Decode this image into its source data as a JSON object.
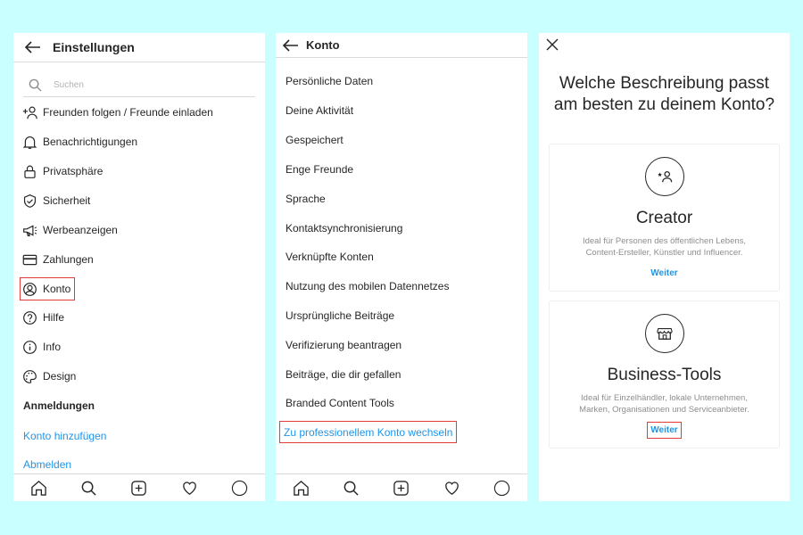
{
  "panel1": {
    "title": "Einstellungen",
    "search_placeholder": "Suchen",
    "items": [
      {
        "label": "Freunden folgen / Freunde einladen",
        "icon": "add-person-icon"
      },
      {
        "label": "Benachrichtigungen",
        "icon": "bell-icon"
      },
      {
        "label": "Privatsphäre",
        "icon": "lock-icon"
      },
      {
        "label": "Sicherheit",
        "icon": "shield-icon"
      },
      {
        "label": "Werbeanzeigen",
        "icon": "megaphone-icon"
      },
      {
        "label": "Zahlungen",
        "icon": "credit-card-icon"
      },
      {
        "label": "Konto",
        "icon": "account-circle-icon"
      },
      {
        "label": "Hilfe",
        "icon": "help-icon"
      },
      {
        "label": "Info",
        "icon": "info-icon"
      },
      {
        "label": "Design",
        "icon": "palette-icon"
      }
    ],
    "section_title": "Anmeldungen",
    "add_account": "Konto hinzufügen",
    "logout": "Abmelden"
  },
  "panel2": {
    "title": "Konto",
    "items": [
      "Persönliche Daten",
      "Deine Aktivität",
      "Gespeichert",
      "Enge Freunde",
      "Sprache",
      "Kontaktsynchronisierung",
      "Verknüpfte Konten",
      "Nutzung des mobilen Datennetzes",
      "Ursprüngliche Beiträge",
      "Verifizierung beantragen",
      "Beiträge, die dir gefallen",
      "Branded Content Tools"
    ],
    "switch_link": "Zu professionellem Konto wechseln"
  },
  "panel3": {
    "question_line1": "Welche Beschreibung passt",
    "question_line2": "am besten zu deinem Konto?",
    "creator": {
      "title": "Creator",
      "desc_line1": "Ideal für Personen des öffentlichen Lebens,",
      "desc_line2": "Content-Ersteller, Künstler und Influencer.",
      "button": "Weiter"
    },
    "business": {
      "title": "Business-Tools",
      "desc_line1": "Ideal für Einzelhändler, lokale Unternehmen,",
      "desc_line2": "Marken, Organisationen und Serviceanbieter.",
      "button": "Weiter"
    }
  },
  "tabbar_icons": [
    "home-icon",
    "search-icon",
    "new-post-icon",
    "heart-icon",
    "profile-icon"
  ],
  "colors": {
    "background": "#caffff",
    "link": "#1f95e9",
    "highlight": "#e23b3b",
    "text": "#262626"
  }
}
